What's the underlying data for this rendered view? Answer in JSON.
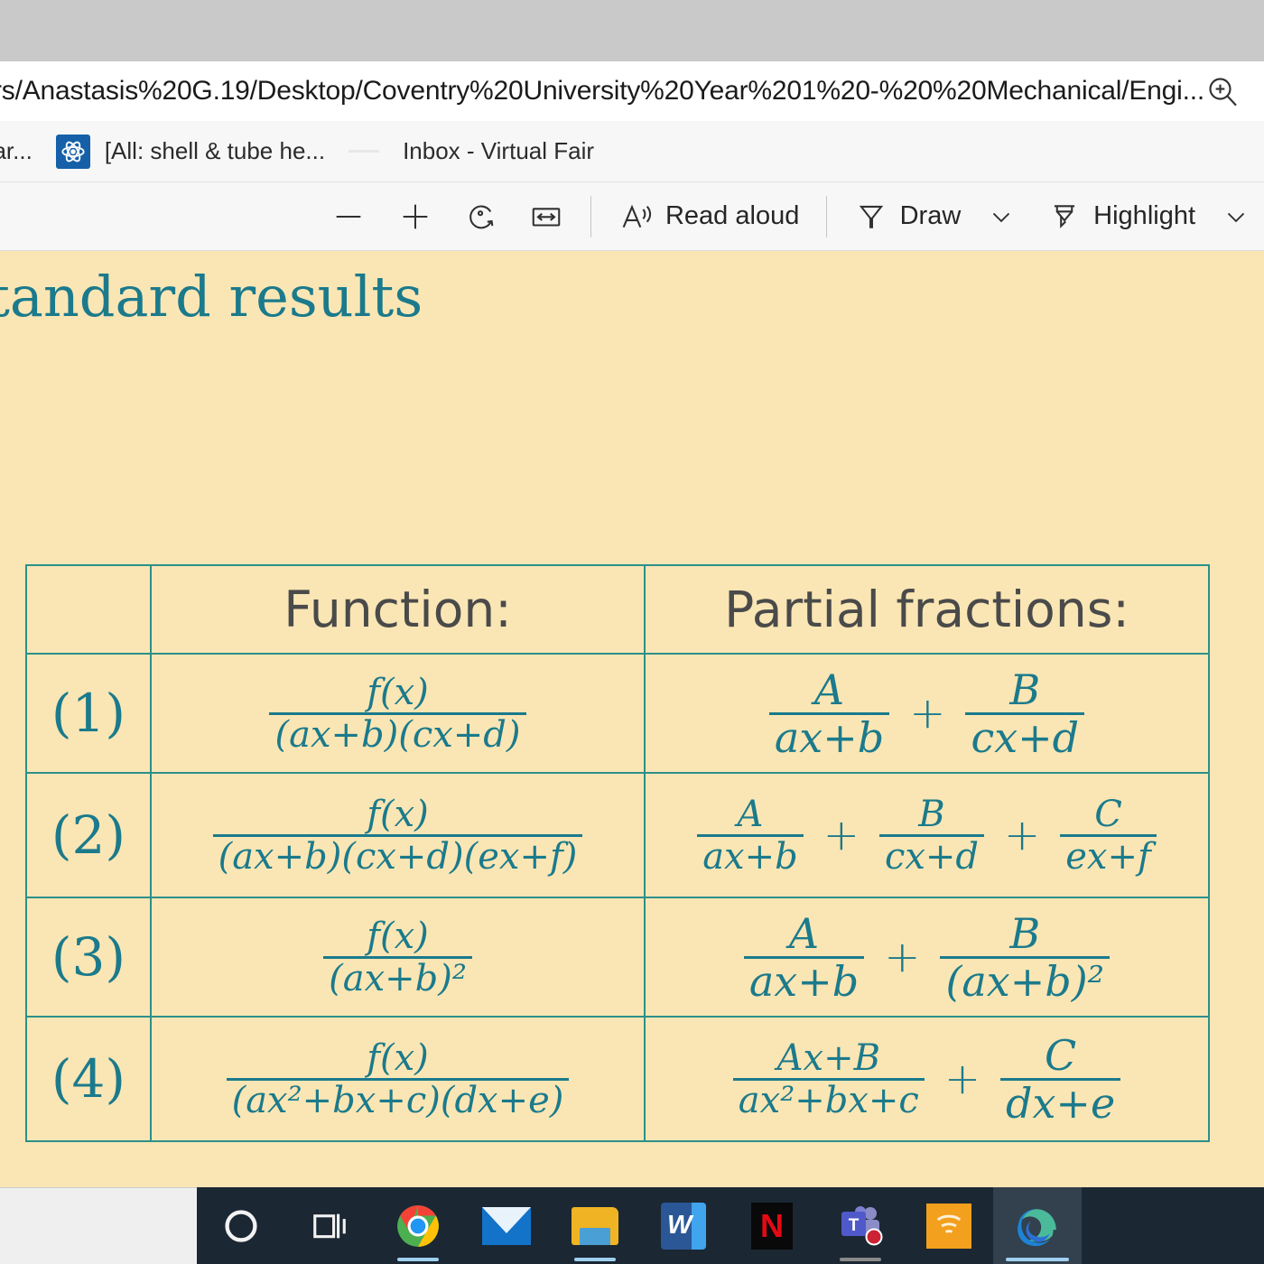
{
  "browser": {
    "url": "rs/Anastasis%20G.19/Desktop/Coventry%20University%20Year%201%20-%20%20Mechanical/Engi...",
    "url_zoom_icon": "zoom-in-search-icon",
    "tabs": [
      {
        "label": "ear...",
        "icon": ""
      },
      {
        "label": "[All: shell & tube he...",
        "icon": "atom-icon"
      },
      {
        "label": "Inbox - Virtual Fair",
        "icon": ""
      }
    ]
  },
  "pdf_toolbar": {
    "zoom_out_label": "—",
    "zoom_in_label": "+",
    "rotate_icon": "rotate-icon",
    "fit_width_icon": "fit-to-width-icon",
    "read_aloud_label": "Read aloud",
    "read_aloud_icon": "read-aloud-icon",
    "draw_label": "Draw",
    "draw_icon": "pen-icon",
    "draw_chevron": "chevron-down-icon",
    "highlight_label": "Highlight",
    "highlight_icon": "highlighter-icon",
    "highlight_chevron": "chevron-down-icon"
  },
  "document": {
    "heading": "tandard results",
    "page_bg": "#fae6b4",
    "accent_color": "#1b7a8c",
    "border_color": "#2d8f8a",
    "table": {
      "headers": [
        "",
        "Function:",
        "Partial fractions:"
      ],
      "rows": [
        {
          "index": "(1)",
          "function": {
            "numerator": "f(x)",
            "denominator": "(ax+b)(cx+d)"
          },
          "partial_fractions": [
            {
              "numerator": "A",
              "denominator": "ax+b"
            },
            {
              "numerator": "B",
              "denominator": "cx+d"
            }
          ],
          "operators": [
            "+"
          ]
        },
        {
          "index": "(2)",
          "function": {
            "numerator": "f(x)",
            "denominator": "(ax+b)(cx+d)(ex+f)"
          },
          "partial_fractions": [
            {
              "numerator": "A",
              "denominator": "ax+b"
            },
            {
              "numerator": "B",
              "denominator": "cx+d"
            },
            {
              "numerator": "C",
              "denominator": "ex+f"
            }
          ],
          "operators": [
            "+",
            "+"
          ]
        },
        {
          "index": "(3)",
          "function": {
            "numerator": "f(x)",
            "denominator": "(ax+b)²"
          },
          "partial_fractions": [
            {
              "numerator": "A",
              "denominator": "ax+b"
            },
            {
              "numerator": "B",
              "denominator": "(ax+b)²"
            }
          ],
          "operators": [
            "+"
          ]
        },
        {
          "index": "(4)",
          "function": {
            "numerator": "f(x)",
            "denominator": "(ax²+bx+c)(dx+e)"
          },
          "partial_fractions": [
            {
              "numerator": "Ax+B",
              "denominator": "ax²+bx+c"
            },
            {
              "numerator": "C",
              "denominator": "dx+e"
            }
          ],
          "operators": [
            "+"
          ]
        }
      ]
    }
  },
  "taskbar": {
    "items": [
      {
        "name": "cortana",
        "icon": "cortana-circle-icon",
        "active": false,
        "underline": "none"
      },
      {
        "name": "task-view",
        "icon": "task-view-icon",
        "active": false,
        "underline": "none"
      },
      {
        "name": "chrome",
        "icon": "chrome-icon",
        "active": false,
        "underline": "blue"
      },
      {
        "name": "mail",
        "icon": "mail-icon",
        "active": false,
        "underline": "none"
      },
      {
        "name": "file-explorer",
        "icon": "folder-icon",
        "active": false,
        "underline": "blue"
      },
      {
        "name": "word",
        "icon": "word-icon",
        "active": false,
        "underline": "none"
      },
      {
        "name": "netflix",
        "icon": "netflix-icon",
        "active": false,
        "underline": "none"
      },
      {
        "name": "teams",
        "icon": "teams-icon",
        "active": false,
        "underline": "blue-gray"
      },
      {
        "name": "audible",
        "icon": "audible-icon",
        "active": false,
        "underline": "none"
      },
      {
        "name": "edge",
        "icon": "edge-icon",
        "active": true,
        "underline": "wide-blue"
      }
    ]
  }
}
